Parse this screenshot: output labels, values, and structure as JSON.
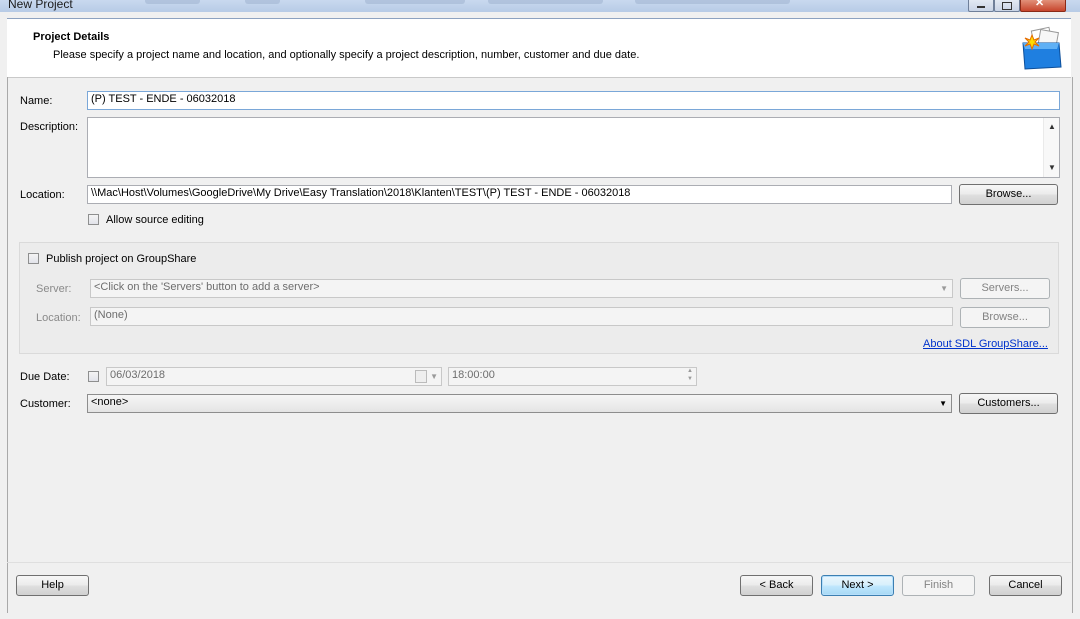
{
  "window": {
    "title": "New Project"
  },
  "header": {
    "title": "Project Details",
    "subtitle": "Please specify a project name and location, and optionally specify a project description, number, customer and due date.",
    "icon": "project-box-icon"
  },
  "form": {
    "name_label": "Name:",
    "name_value": "(P) TEST - ENDE - 06032018",
    "description_label": "Description:",
    "description_value": "",
    "location_label": "Location:",
    "location_value": "\\\\Mac\\Host\\Volumes\\GoogleDrive\\My Drive\\Easy Translation\\2018\\Klanten\\TEST\\(P) TEST - ENDE - 06032018",
    "browse_label": "Browse...",
    "allow_source_editing_label": "Allow source editing",
    "allow_source_editing_checked": false
  },
  "groupshare": {
    "publish_label": "Publish project on GroupShare",
    "publish_checked": false,
    "server_label": "Server:",
    "server_value": "<Click on the 'Servers' button to add a server>",
    "servers_button": "Servers...",
    "location_label": "Location:",
    "location_value": "(None)",
    "browse_button": "Browse...",
    "about_link": "About SDL GroupShare..."
  },
  "due": {
    "label": "Due Date:",
    "checked": false,
    "date_value": "06/03/2018",
    "time_value": "18:00:00"
  },
  "customer": {
    "label": "Customer:",
    "value": "<none>",
    "button": "Customers..."
  },
  "footer": {
    "help": "Help",
    "back": "< Back",
    "next": "Next >",
    "finish": "Finish",
    "cancel": "Cancel"
  }
}
